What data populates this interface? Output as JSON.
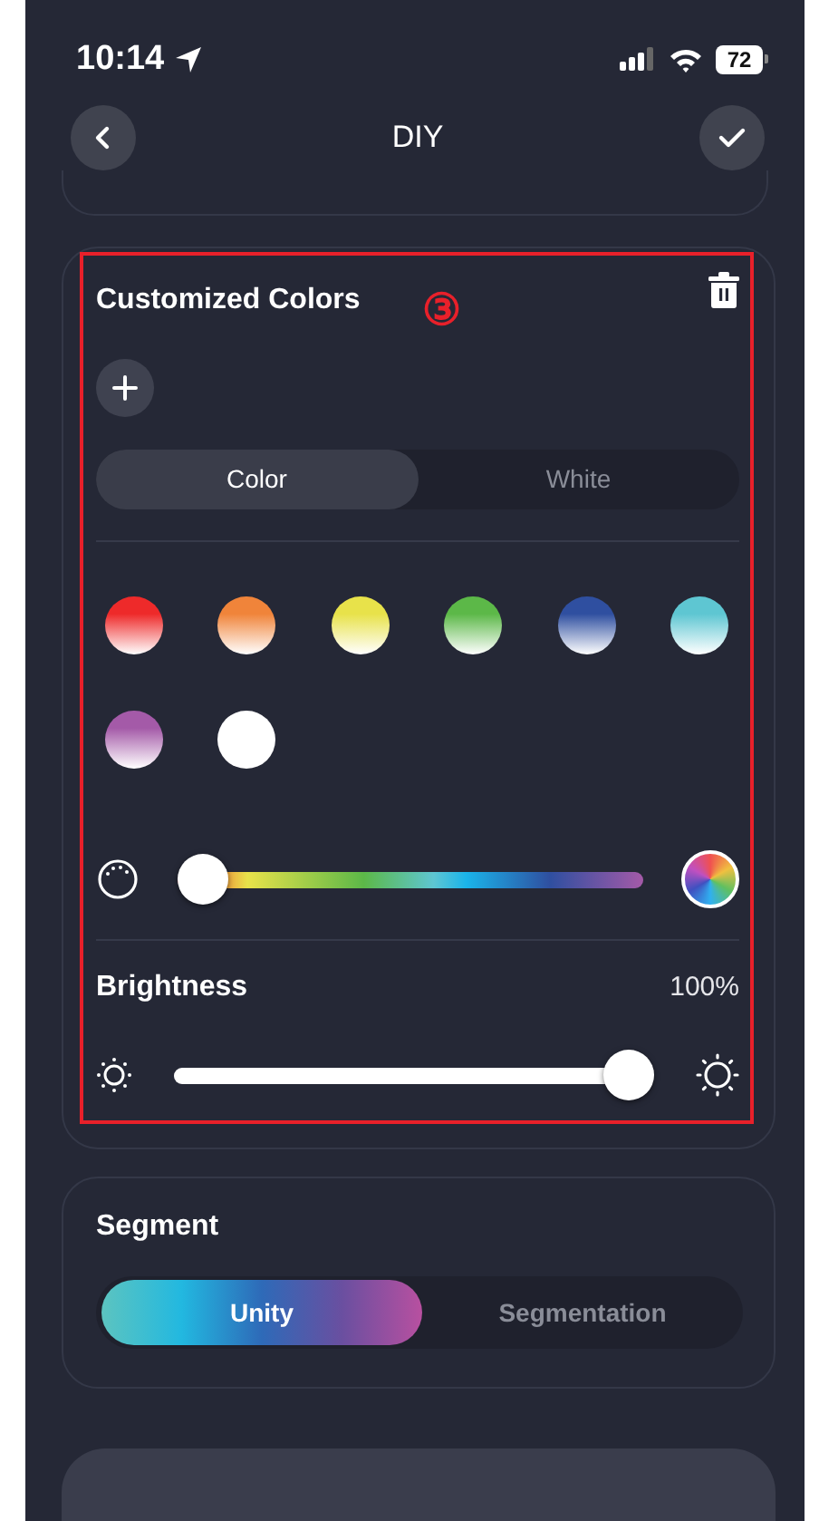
{
  "status_bar": {
    "time": "10:14",
    "battery": "72"
  },
  "nav": {
    "title": "DIY"
  },
  "custom_colors": {
    "title": "Customized Colors",
    "annotation": "③",
    "tabs": [
      {
        "label": "Color",
        "selected": true
      },
      {
        "label": "White",
        "selected": false
      }
    ],
    "swatches": [
      {
        "color": "#ee2a2a"
      },
      {
        "color": "#f0843a"
      },
      {
        "color": "#e8e24a"
      },
      {
        "color": "#5cb848"
      },
      {
        "color": "#2f4fa0"
      },
      {
        "color": "#5ec6d2"
      },
      {
        "color": "#a45aa8"
      },
      {
        "color": "#ffffff"
      }
    ],
    "hue_slider": {
      "level": 0
    },
    "brightness": {
      "label": "Brightness",
      "reading": "100%",
      "level": 1
    }
  },
  "segment": {
    "title": "Segment",
    "options": [
      {
        "label": "Unity",
        "selected": true
      },
      {
        "label": "Segmentation",
        "selected": false
      }
    ]
  }
}
